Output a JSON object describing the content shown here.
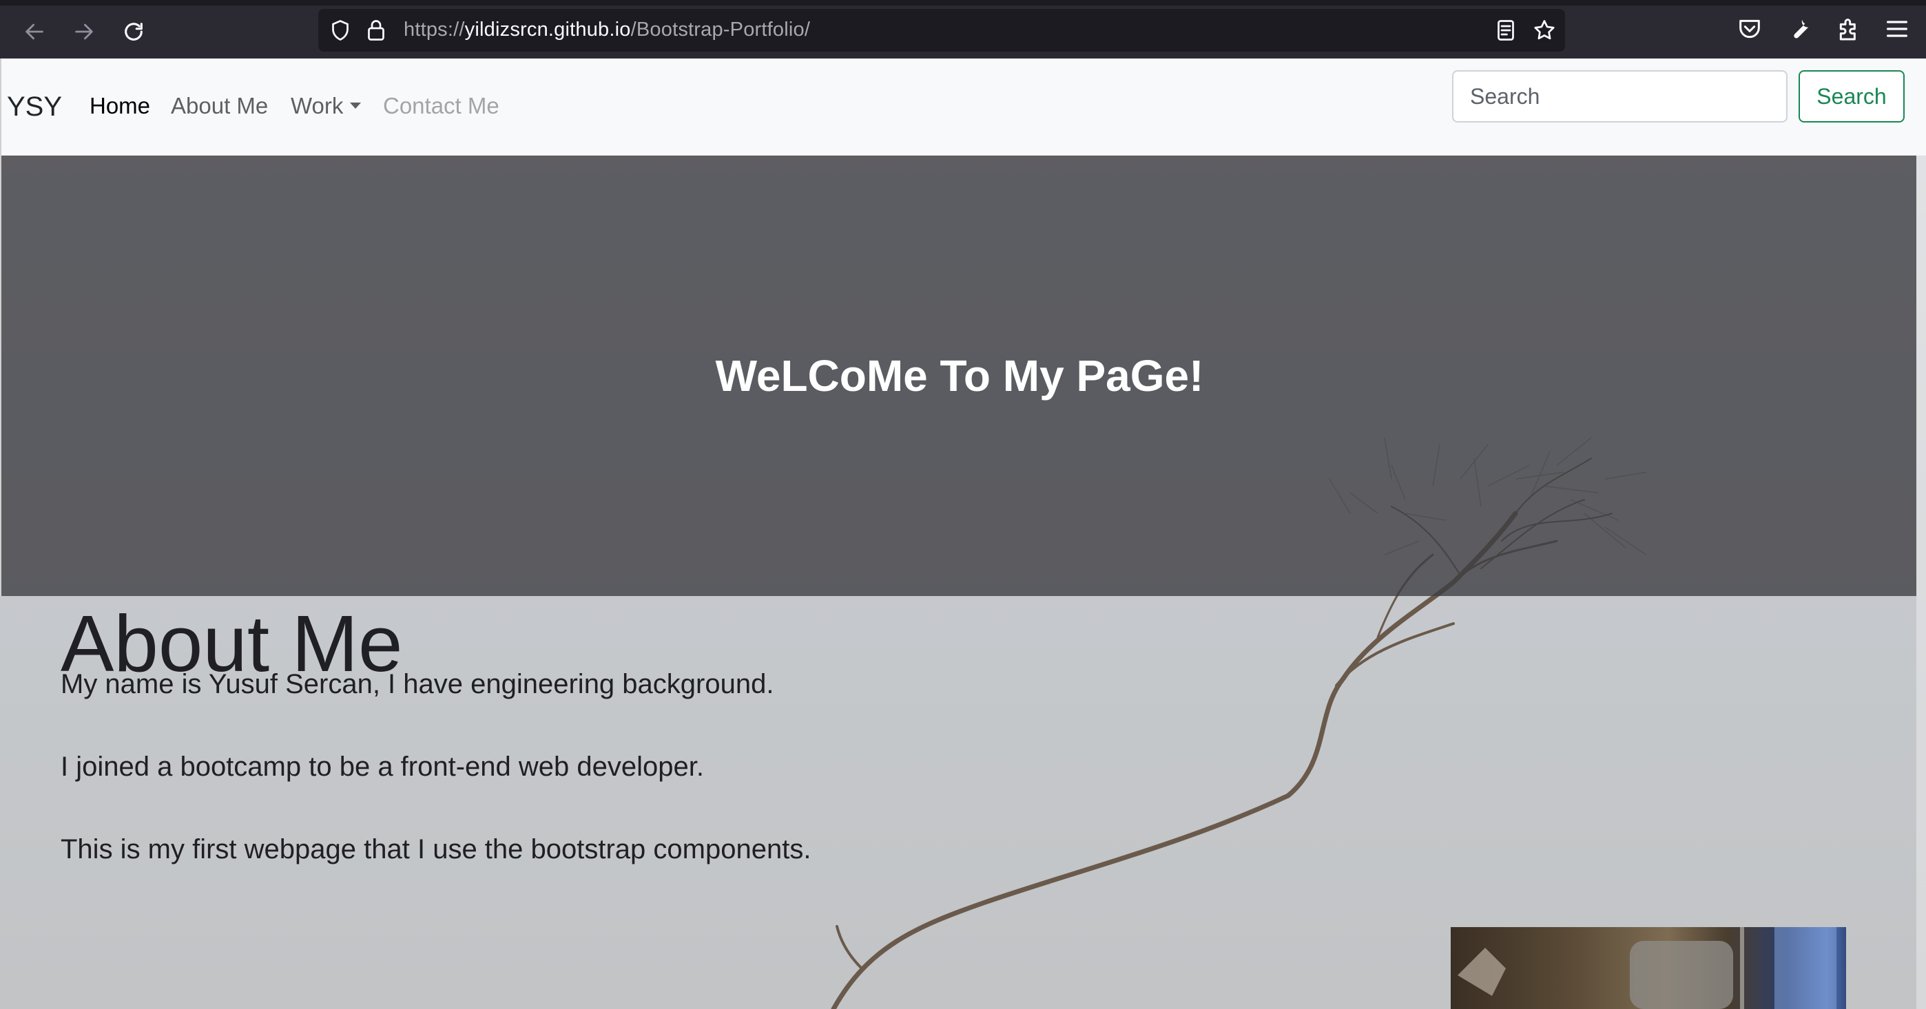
{
  "browser": {
    "url_prefix": "https://",
    "url_domain": "yildizsrcn.github.io",
    "url_path": "/Bootstrap-Portfolio/",
    "icons": {
      "back": "arrow-left-icon",
      "forward": "arrow-right-icon",
      "reload": "reload-icon",
      "tracking": "shield-icon",
      "security": "lock-icon",
      "reader": "reader-view-icon",
      "bookmark": "star-icon",
      "pocket": "pocket-icon",
      "tools": "wrench-icon",
      "extensions": "puzzle-icon",
      "menu": "hamburger-menu-icon"
    }
  },
  "navbar": {
    "brand": "YSY",
    "links": [
      {
        "label": "Home",
        "state": "active"
      },
      {
        "label": "About Me",
        "state": "normal"
      },
      {
        "label": "Work",
        "state": "dropdown"
      },
      {
        "label": "Contact Me",
        "state": "disabled"
      }
    ],
    "search": {
      "placeholder": "Search",
      "button_label": "Search"
    },
    "accent_color": "#198754"
  },
  "hero": {
    "title": "WeLCoMe To My PaGe!"
  },
  "about": {
    "heading": "About Me",
    "paragraphs": [
      "My name is Yusuf Sercan, I have engineering background.",
      "I joined a bootcamp to be a front-end web developer.",
      "This is my first webpage that I use the bootstrap components."
    ]
  }
}
